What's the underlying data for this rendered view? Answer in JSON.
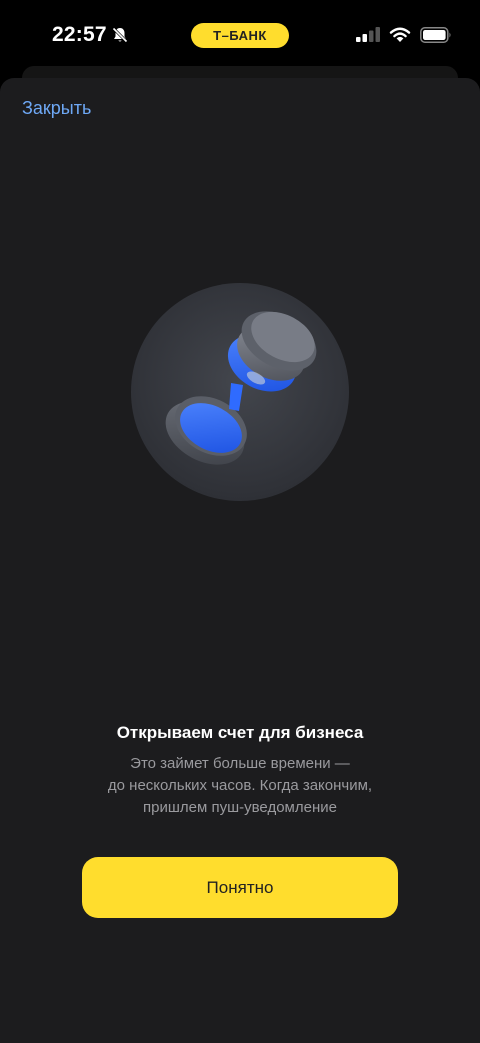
{
  "status_bar": {
    "time": "22:57",
    "carrier": "Т–БАНК",
    "icons": [
      "bell-slash-icon",
      "signal-icon",
      "wifi-icon",
      "battery-icon"
    ]
  },
  "sheet": {
    "close_label": "Закрыть",
    "illustration_icon": "hourglass-icon",
    "title": "Открываем счет для бизнеса",
    "subtitle_lines": [
      "Это займет больше времени —",
      "до нескольких часов. Когда закончим,",
      "пришлем пуш-уведомление"
    ],
    "button_label": "Понятно"
  },
  "colors": {
    "accent_yellow": "#FFDD2D",
    "link_blue": "#6EA8F5",
    "sheet_bg": "#1C1C1E",
    "hourglass_blue": "#2F6BFF"
  }
}
